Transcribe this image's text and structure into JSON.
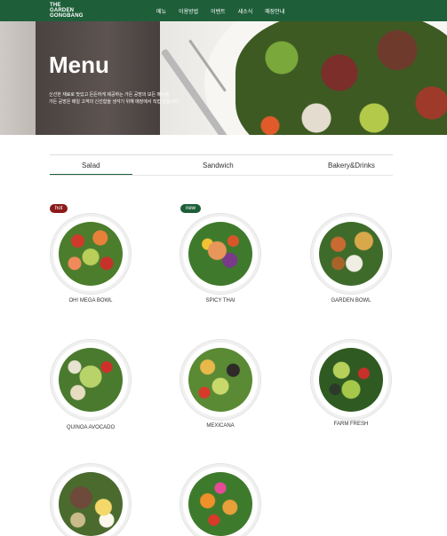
{
  "header": {
    "logo_line1": "THE",
    "logo_line2": "GARDEN",
    "logo_line3": "GONGBANG",
    "nav": [
      "메뉴",
      "이용방법",
      "이벤트",
      "새소식",
      "매장안내"
    ]
  },
  "hero": {
    "title": "Menu",
    "desc_line1": "신선한 재료로 맛있고 든든하게 제공하는 가든 공방의 모든 메뉴들,",
    "desc_line2": "가든 공방은 매일 고객의 신선함을 생각기 위해 매장에서 직접 만듭니다."
  },
  "tabs": [
    "Salad",
    "Sandwich",
    "Bakery&Drinks"
  ],
  "active_tab": "Salad",
  "items": [
    {
      "name": "OH! MEGA BOWL",
      "badge": "hot"
    },
    {
      "name": "SPICY THAI",
      "badge": "new"
    },
    {
      "name": "GARDEN BOWL",
      "badge": ""
    },
    {
      "name": "QUINOA AVOCADO",
      "badge": ""
    },
    {
      "name": "MEXICANA",
      "badge": ""
    },
    {
      "name": "FARM FRESH",
      "badge": ""
    },
    {
      "name": "",
      "badge": ""
    },
    {
      "name": "",
      "badge": ""
    }
  ],
  "colors": {
    "brand_green": "#1e5f3a",
    "hot_badge": "#8c1a1a"
  }
}
